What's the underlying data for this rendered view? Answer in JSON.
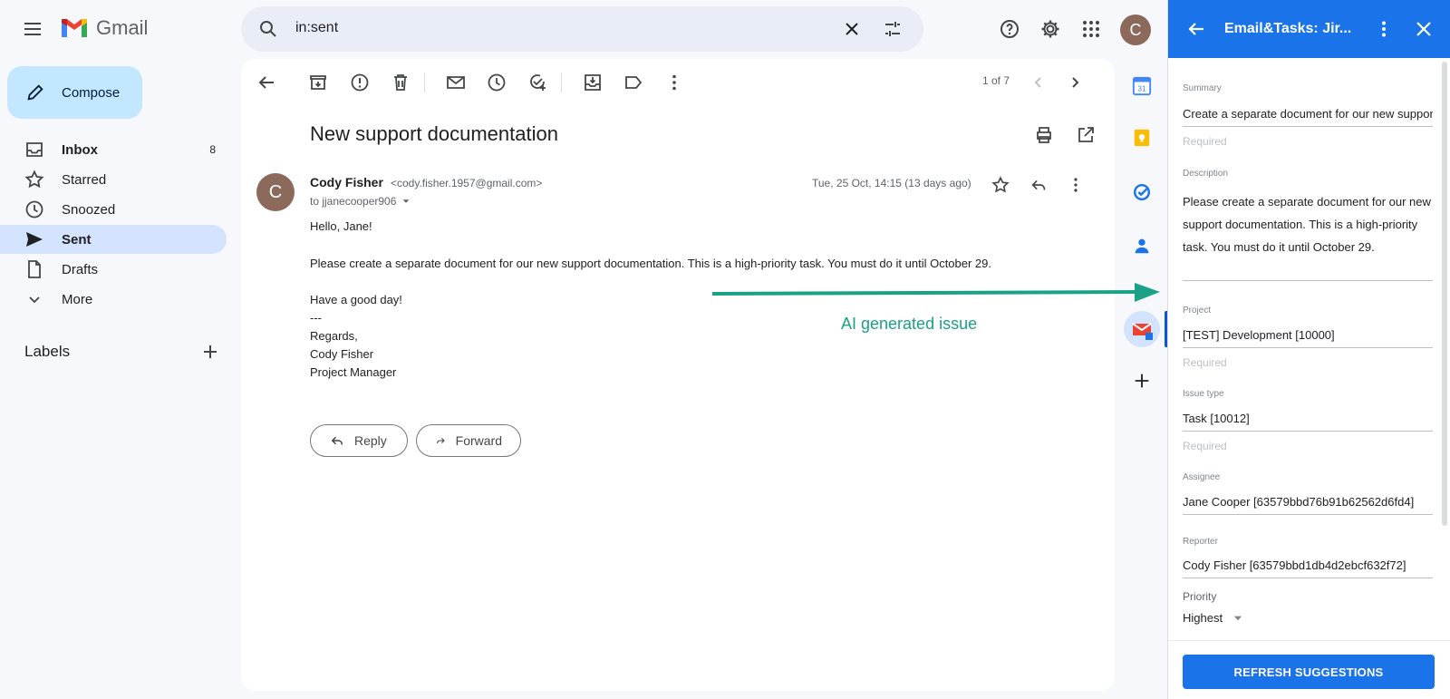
{
  "app": {
    "name": "Gmail"
  },
  "search": {
    "value": "in:sent"
  },
  "user": {
    "initial": "C"
  },
  "compose": {
    "label": "Compose"
  },
  "nav": {
    "items": [
      {
        "label": "Inbox",
        "count": "8",
        "icon": "inbox-icon"
      },
      {
        "label": "Starred",
        "count": "",
        "icon": "star-icon"
      },
      {
        "label": "Snoozed",
        "count": "",
        "icon": "clock-icon"
      },
      {
        "label": "Sent",
        "count": "",
        "icon": "send-icon"
      },
      {
        "label": "Drafts",
        "count": "",
        "icon": "draft-icon"
      },
      {
        "label": "More",
        "count": "",
        "icon": "chevron-down-icon"
      }
    ],
    "labels_heading": "Labels"
  },
  "toolbar": {
    "pager": "1 of 7"
  },
  "message": {
    "subject": "New support documentation",
    "sender_initial": "C",
    "sender_name": "Cody Fisher",
    "sender_email": "<cody.fisher.1957@gmail.com>",
    "to": "to jjanecooper906",
    "date": "Tue, 25 Oct, 14:15 (13 days ago)",
    "body": [
      "Hello, Jane!",
      "Please create a separate document for our new support documentation. This is a high-priority task. You must do it until October 29.",
      "Have a good day!",
      "---",
      "Regards,",
      "Cody Fisher",
      "Project Manager"
    ],
    "reply_label": "Reply",
    "forward_label": "Forward"
  },
  "annotation": {
    "label": "AI generated issue",
    "color": "#1aa186"
  },
  "panel": {
    "title": "Email&Tasks: Jir...",
    "summary_label": "Summary",
    "summary_value": "Create a separate document for our new support documentation",
    "summary_help": "Required",
    "description_label": "Description",
    "description_value": "Please create a separate document for our new support documentation. This is a high-priority task. You must do it until October 29.",
    "project_label": "Project",
    "project_value": "[TEST] Development [10000]",
    "project_help": "Required",
    "issue_type_label": "Issue type",
    "issue_type_value": "Task [10012]",
    "issue_type_help": "Required",
    "assignee_label": "Assignee",
    "assignee_value": "Jane Cooper [63579bbd76b91b62562d6fd4]",
    "reporter_label": "Reporter",
    "reporter_value": "Cody Fisher [63579bbd1db4d2ebcf632f72]",
    "priority_label": "Priority",
    "priority_value": "Highest",
    "refresh_label": "REFRESH SUGGESTIONS",
    "accent_color": "#1a73e8"
  }
}
